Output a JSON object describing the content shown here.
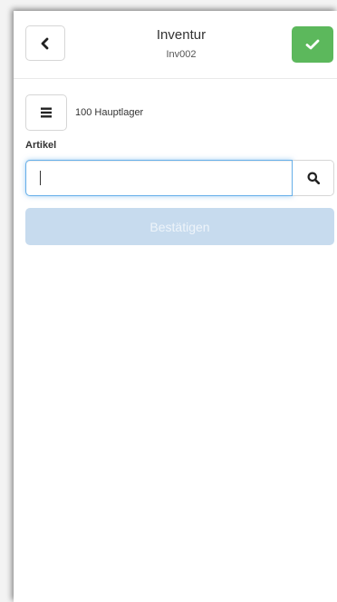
{
  "header": {
    "title": "Inventur",
    "subtitle": "Inv002",
    "back_icon": "chevron-left-icon",
    "ok_icon": "check-icon",
    "ok_color": "#5cb85c"
  },
  "warehouse": {
    "menu_icon": "menu-icon",
    "label": "100 Hauptlager"
  },
  "article": {
    "label": "Artikel",
    "value": "",
    "search_icon": "search-icon"
  },
  "confirm": {
    "label": "Bestätigen",
    "state": "disabled",
    "color": "#c7dbee"
  }
}
